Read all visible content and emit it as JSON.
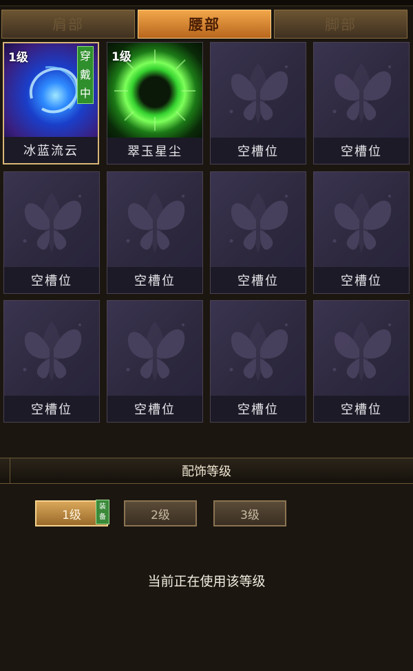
{
  "tabs": [
    {
      "label": "肩部",
      "active": false
    },
    {
      "label": "腰部",
      "active": true
    },
    {
      "label": "脚部",
      "active": false
    }
  ],
  "slots": [
    {
      "label": "冰蓝流云",
      "level": "1级",
      "badge": "穿戴中",
      "icon": "blue-swirl-icon",
      "accent": "#2f6fe0"
    },
    {
      "label": "翠玉星尘",
      "level": "1级",
      "icon": "green-burst-icon",
      "accent": "#35d22f"
    },
    {
      "label": "空槽位"
    },
    {
      "label": "空槽位"
    },
    {
      "label": "空槽位"
    },
    {
      "label": "空槽位"
    },
    {
      "label": "空槽位"
    },
    {
      "label": "空槽位"
    },
    {
      "label": "空槽位"
    },
    {
      "label": "空槽位"
    },
    {
      "label": "空槽位"
    },
    {
      "label": "空槽位"
    }
  ],
  "empty_icon": "butterfly-icon",
  "section": {
    "title": "配饰等级"
  },
  "levels": [
    {
      "label": "1级",
      "active": true
    },
    {
      "label": "2级",
      "active": false
    },
    {
      "label": "3级",
      "active": false
    }
  ],
  "equip_tag": "装备",
  "status": "当前正在使用该等级"
}
